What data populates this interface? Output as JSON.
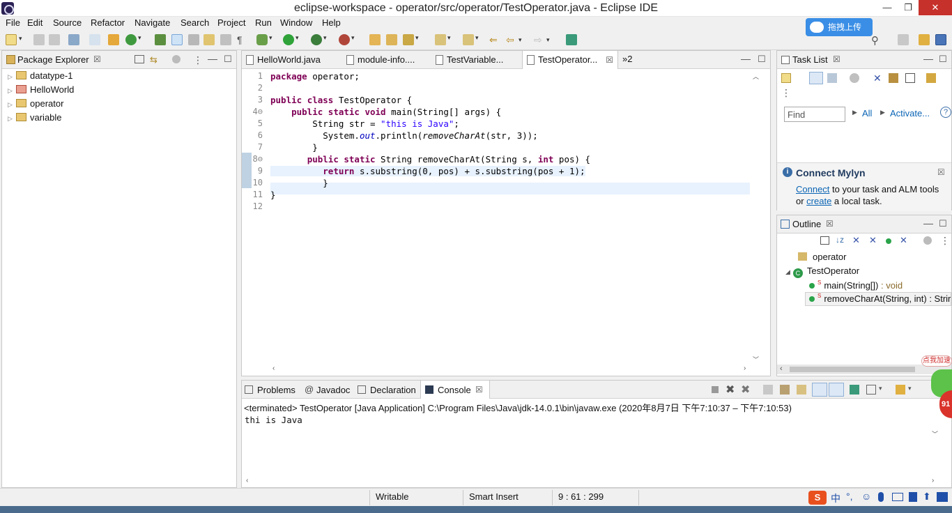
{
  "window": {
    "title": "eclipse-workspace - operator/src/operator/TestOperator.java - Eclipse IDE",
    "minimize": "—",
    "restore": "❐",
    "close": "✕"
  },
  "menu": [
    "File",
    "Edit",
    "Source",
    "Refactor",
    "Navigate",
    "Search",
    "Project",
    "Run",
    "Window",
    "Help"
  ],
  "upload_button": "拖拽上传",
  "package_explorer": {
    "title": "Package Explorer",
    "projects": [
      "datatype-1",
      "HelloWorld",
      "operator",
      "variable"
    ]
  },
  "editor": {
    "tabs": [
      "HelloWorld.java",
      "module-info....",
      "TestVariable...",
      "TestOperator..."
    ],
    "overflow": "»2",
    "line_numbers": [
      "1",
      "2",
      "3",
      "4⊖",
      "5",
      "6",
      "7",
      "8⊖",
      "9",
      "10",
      "11",
      "12"
    ],
    "code": [
      "package operator;",
      "",
      "public class TestOperator {",
      "    public static void main(String[] args) {",
      "        String str = \"this is Java\";",
      "          System.out.println(removeCharAt(str, 3));",
      "        }",
      "       public static String removeCharAt(String s, int pos) {",
      "          return s.substring(0, pos) + s.substring(pos + 1);",
      "          }",
      "}",
      ""
    ]
  },
  "task_list": {
    "title": "Task List",
    "find_placeholder": "Find",
    "all": "All",
    "activate": "Activate...",
    "mylyn_title": "Connect Mylyn",
    "mylyn_connect": "Connect",
    "mylyn_text1": " to your task and ALM tools",
    "mylyn_or": "or ",
    "mylyn_create": "create",
    "mylyn_text2": " a local task."
  },
  "outline": {
    "title": "Outline",
    "package": "operator",
    "class": "TestOperator",
    "method1": "main(String[])",
    "method1_type": " : void",
    "method2": "removeCharAt(String, int) : Strir"
  },
  "console": {
    "tabs": [
      "Problems",
      "Javadoc",
      "Declaration",
      "Console"
    ],
    "header": "<terminated> TestOperator [Java Application] C:\\Program Files\\Java\\jdk-14.0.1\\bin\\javaw.exe  (2020年8月7日 下午7:10:37 – 下午7:10:53)",
    "output": "thi is Java"
  },
  "status": {
    "writable": "Writable",
    "insert_mode": "Smart Insert",
    "position": "9 : 61 : 299"
  },
  "overlay": {
    "badge_text": "点我加速",
    "badge_number": "91"
  },
  "colors": {
    "keyword": "#7f0055",
    "string": "#2a00ff",
    "field": "#0000c0",
    "current_line": "#e8f2fe",
    "close_button": "#c7312b"
  }
}
